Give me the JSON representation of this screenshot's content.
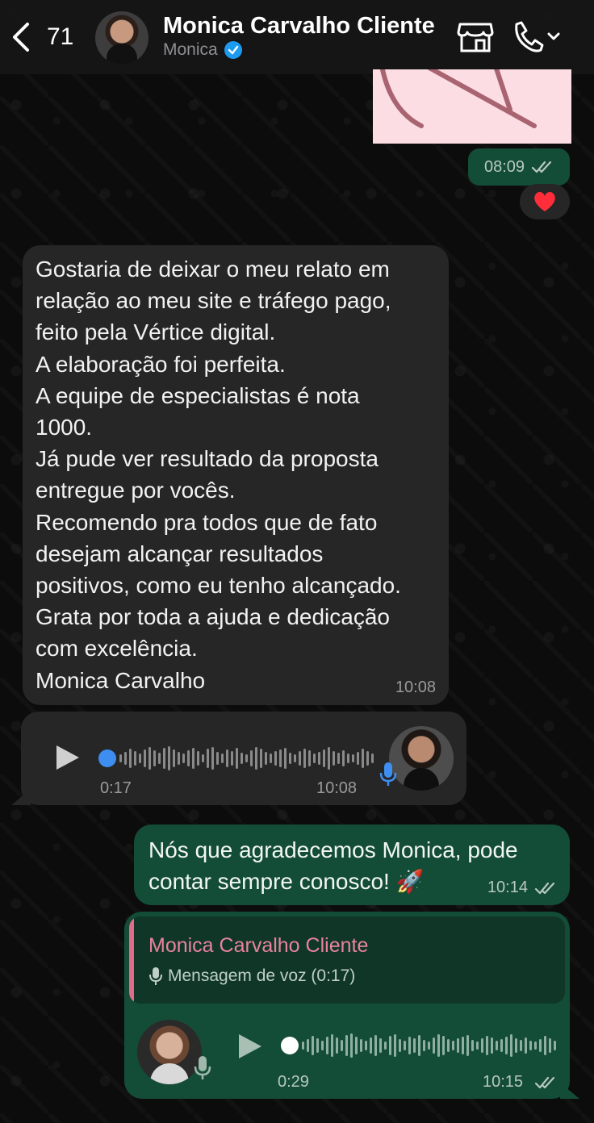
{
  "header": {
    "back_count": "71",
    "contact_name": "Monica Carvalho Cliente",
    "contact_subtitle": "Monica"
  },
  "messages": {
    "photo_time": "08:09",
    "reaction": "❤️",
    "incoming_text": {
      "lines": [
        "Gostaria de deixar o meu relato em",
        "relação ao meu site e tráfego pago,",
        "feito pela Vértice digital.",
        "A elaboração foi perfeita.",
        "A equipe de especialistas é nota",
        "1000.",
        "Já pude ver resultado da proposta",
        "entregue por vocês.",
        "Recomendo pra todos que de fato",
        "desejam alcançar resultados",
        "positivos, como eu tenho alcançado.",
        "Grata por toda a ajuda e dedicação",
        "com excelência.",
        "Monica Carvalho"
      ],
      "time": "10:08"
    },
    "incoming_voice": {
      "duration": "0:17",
      "time": "10:08",
      "progress": 0
    },
    "outgoing_text": {
      "line1": "Nós que agradecemos Monica, pode",
      "line2": "contar sempre conosco! 🚀",
      "time": "10:14"
    },
    "outgoing_reply": {
      "quoted_name": "Monica Carvalho Cliente",
      "quoted_text": "Mensagem de voz (0:17)",
      "duration": "0:29",
      "time": "10:15",
      "progress": 0
    }
  },
  "colors": {
    "outgoing_bubble": "#144d37",
    "incoming_bubble": "#262626",
    "accent_blue": "#1d9bf0",
    "quote_pink": "#e06b8a"
  }
}
